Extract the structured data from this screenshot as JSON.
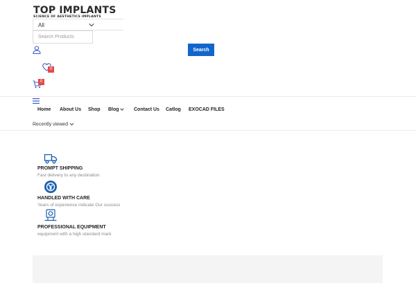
{
  "logo": {
    "title": "TOP IMPLANTS",
    "tagline": "SCIENCE OF AESTHETICS IMPLANTS"
  },
  "search": {
    "category_value": "All",
    "placeholder": "Search Products",
    "button_label": "Search"
  },
  "header": {
    "wishlist_count": "0",
    "cart_count": "0"
  },
  "nav": {
    "items": [
      "Home",
      "About Us",
      "Shop",
      "Blog",
      "Contact Us",
      "Catlog",
      "EXOCAD FILES"
    ]
  },
  "recently_viewed": {
    "label": "Recently viewed"
  },
  "features": [
    {
      "icon": "truck-icon",
      "title": "PROMPT SHIPPING",
      "desc": "Fast delivery to any destination"
    },
    {
      "icon": "care-icon",
      "title": "HANDLED WITH CARE",
      "desc": "Years of experience indicate Our success"
    },
    {
      "icon": "equipment-icon",
      "title": "PROFESSIONAL EQUIPMENT",
      "desc": "equipment with a high standard mark"
    }
  ],
  "colors": {
    "accent": "#1166cc",
    "badge": "#e34b4b",
    "footer_bg": "#f4f4f4"
  }
}
